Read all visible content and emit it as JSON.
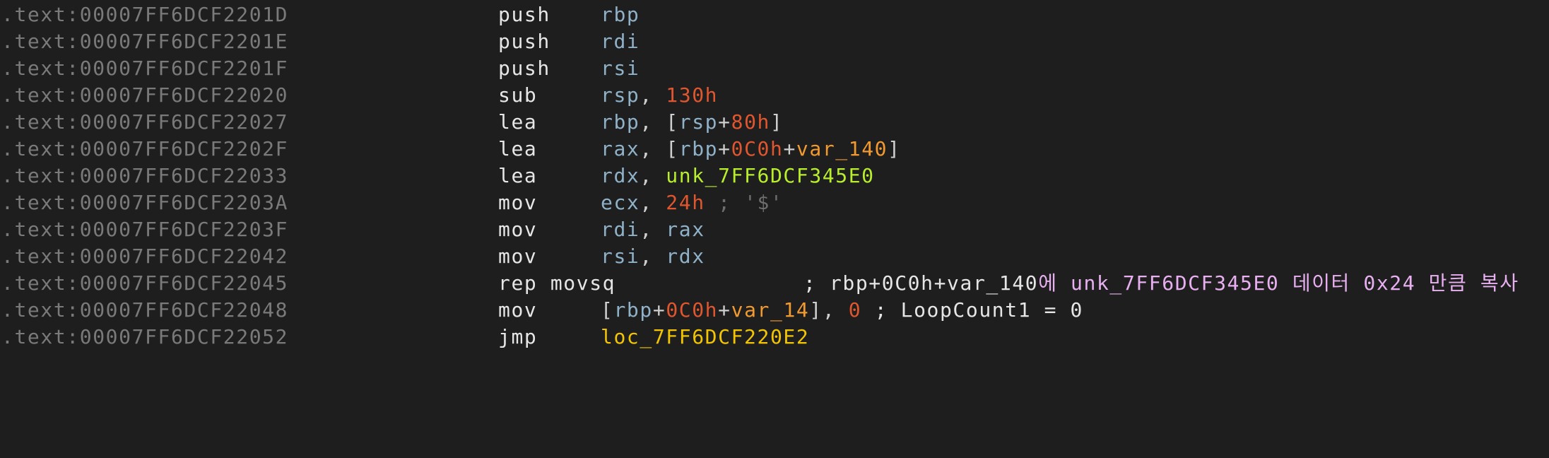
{
  "disassembly": {
    "lines": [
      {
        "address": ".text:00007FF6DCF2201D",
        "mnemonic": "push",
        "reg": "rbp"
      },
      {
        "address": ".text:00007FF6DCF2201E",
        "mnemonic": "push",
        "reg": "rdi"
      },
      {
        "address": ".text:00007FF6DCF2201F",
        "mnemonic": "push",
        "reg": "rsi"
      },
      {
        "address": ".text:00007FF6DCF22020",
        "mnemonic": "sub",
        "reg": "rsp",
        "comma": ", ",
        "num": "130h"
      },
      {
        "address": ".text:00007FF6DCF22027",
        "mnemonic": "lea",
        "reg": "rbp",
        "comma": ", ",
        "open": "[",
        "base": "rsp",
        "plus": "+",
        "num": "80h",
        "close": "]"
      },
      {
        "address": ".text:00007FF6DCF2202F",
        "mnemonic": "lea",
        "reg": "rax",
        "comma": ", ",
        "open": "[",
        "base": "rbp",
        "plus": "+",
        "num": "0C0h",
        "plus2": "+",
        "var": "var_140",
        "close": "]"
      },
      {
        "address": ".text:00007FF6DCF22033",
        "mnemonic": "lea",
        "reg": "rdx",
        "comma": ", ",
        "symbol": "unk_7FF6DCF345E0"
      },
      {
        "address": ".text:00007FF6DCF2203A",
        "mnemonic": "mov",
        "reg": "ecx",
        "comma": ", ",
        "num": "24h",
        "comment": " ; '$'"
      },
      {
        "address": ".text:00007FF6DCF2203F",
        "mnemonic": "mov",
        "reg": "rdi",
        "comma": ", ",
        "reg2": "rax"
      },
      {
        "address": ".text:00007FF6DCF22042",
        "mnemonic": "mov",
        "reg": "rsi",
        "comma": ", ",
        "reg2": "rdx"
      },
      {
        "address": ".text:00007FF6DCF22045",
        "mnemonic": "rep movsq",
        "comment_plain": "; rbp+0C0h+var_140",
        "comment_user": "에 unk_7FF6DCF345E0 데이터 0x24 만큼 복사"
      },
      {
        "address": ".text:00007FF6DCF22048",
        "mnemonic": "mov",
        "open": "[",
        "base": "rbp",
        "plus": "+",
        "num": "0C0h",
        "plus2": "+",
        "var": "var_14",
        "close": "]",
        "comma": ", ",
        "num2": "0",
        "comment": " ; LoopCount1 = 0"
      },
      {
        "address": ".text:00007FF6DCF22052",
        "mnemonic": "jmp",
        "loc": "loc_7FF6DCF220E2"
      }
    ]
  }
}
